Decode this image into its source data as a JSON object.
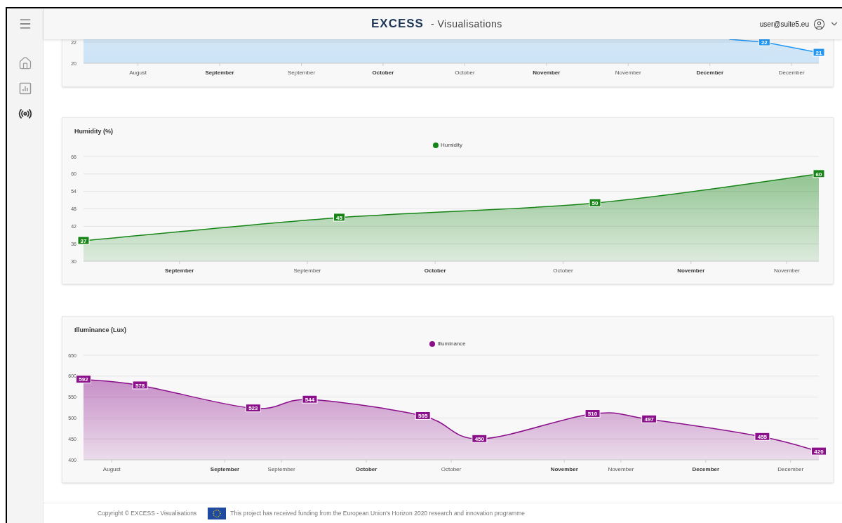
{
  "sidebar": {
    "items": [
      {
        "kind": "home",
        "selected": false
      },
      {
        "kind": "chart",
        "selected": false
      },
      {
        "kind": "sensors",
        "selected": true
      }
    ]
  },
  "header": {
    "logo": "EXCESS",
    "title": "- Visualisations",
    "user": "user@suite5.eu"
  },
  "charts": [
    {
      "chart_data": {
        "type": "area",
        "grid": true,
        "ylim": [
          20,
          22.27
        ],
        "yticks": [
          20,
          22
        ],
        "data_labels": true,
        "categories": [
          null,
          null,
          "August",
          null,
          null,
          "**September**",
          null,
          null,
          "September",
          null,
          null,
          "**October**",
          null,
          null,
          "October",
          null,
          null,
          "**November**",
          null,
          null,
          "November",
          null,
          null,
          "**December**",
          null,
          null,
          "December",
          null
        ],
        "series": [
          {
            "color": "#2196f3",
            "values": [
              null,
              null,
              null,
              null,
              null,
              null,
              null,
              null,
              null,
              null,
              null,
              null,
              null,
              null,
              null,
              null,
              null,
              null,
              null,
              null,
              null,
              null,
              null,
              null,
              null,
              22,
              null,
              21
            ]
          }
        ]
      }
    },
    {
      "chart_data": {
        "type": "area",
        "grid": true,
        "title": "Humidity (%)",
        "ylim": [
          30,
          66
        ],
        "yticks": [
          30,
          36,
          42,
          48,
          54,
          60,
          66
        ],
        "data_labels": true,
        "categories": [
          null,
          null,
          null,
          "**September**",
          null,
          null,
          null,
          "September",
          null,
          null,
          null,
          "**October**",
          null,
          null,
          null,
          "October",
          null,
          null,
          null,
          "**November**",
          null,
          null,
          "November",
          null
        ],
        "series": [
          {
            "name": "Humidity",
            "color": "#168516",
            "values": [
              37,
              null,
              null,
              null,
              null,
              null,
              null,
              null,
              45,
              null,
              null,
              null,
              null,
              null,
              null,
              null,
              50,
              null,
              null,
              null,
              null,
              null,
              null,
              60
            ]
          }
        ]
      }
    },
    {
      "chart_data": {
        "type": "area",
        "grid": true,
        "title": "Illuminance (Lux)",
        "ylim": [
          400,
          650
        ],
        "yticks": [
          400,
          450,
          500,
          550,
          600,
          650
        ],
        "data_labels": true,
        "categories": [
          null,
          "August",
          null,
          null,
          null,
          "**September**",
          null,
          "September",
          null,
          null,
          "**October**",
          null,
          null,
          "October",
          null,
          null,
          null,
          "**November**",
          null,
          "November",
          null,
          null,
          "**December**",
          null,
          null,
          "December",
          null
        ],
        "series": [
          {
            "name": "Illuminance",
            "color": "#8b0f8b",
            "values": [
              592,
              null,
              578,
              null,
              null,
              null,
              523,
              null,
              544,
              null,
              null,
              null,
              505,
              null,
              450,
              null,
              null,
              null,
              510,
              null,
              497,
              null,
              null,
              null,
              455,
              null,
              420
            ]
          }
        ]
      }
    }
  ],
  "footer": {
    "copyright": "Copyright © EXCESS - Visualisations",
    "funding": "This project has received funding from the European Union's Horizon 2020 research and innovation programme"
  }
}
